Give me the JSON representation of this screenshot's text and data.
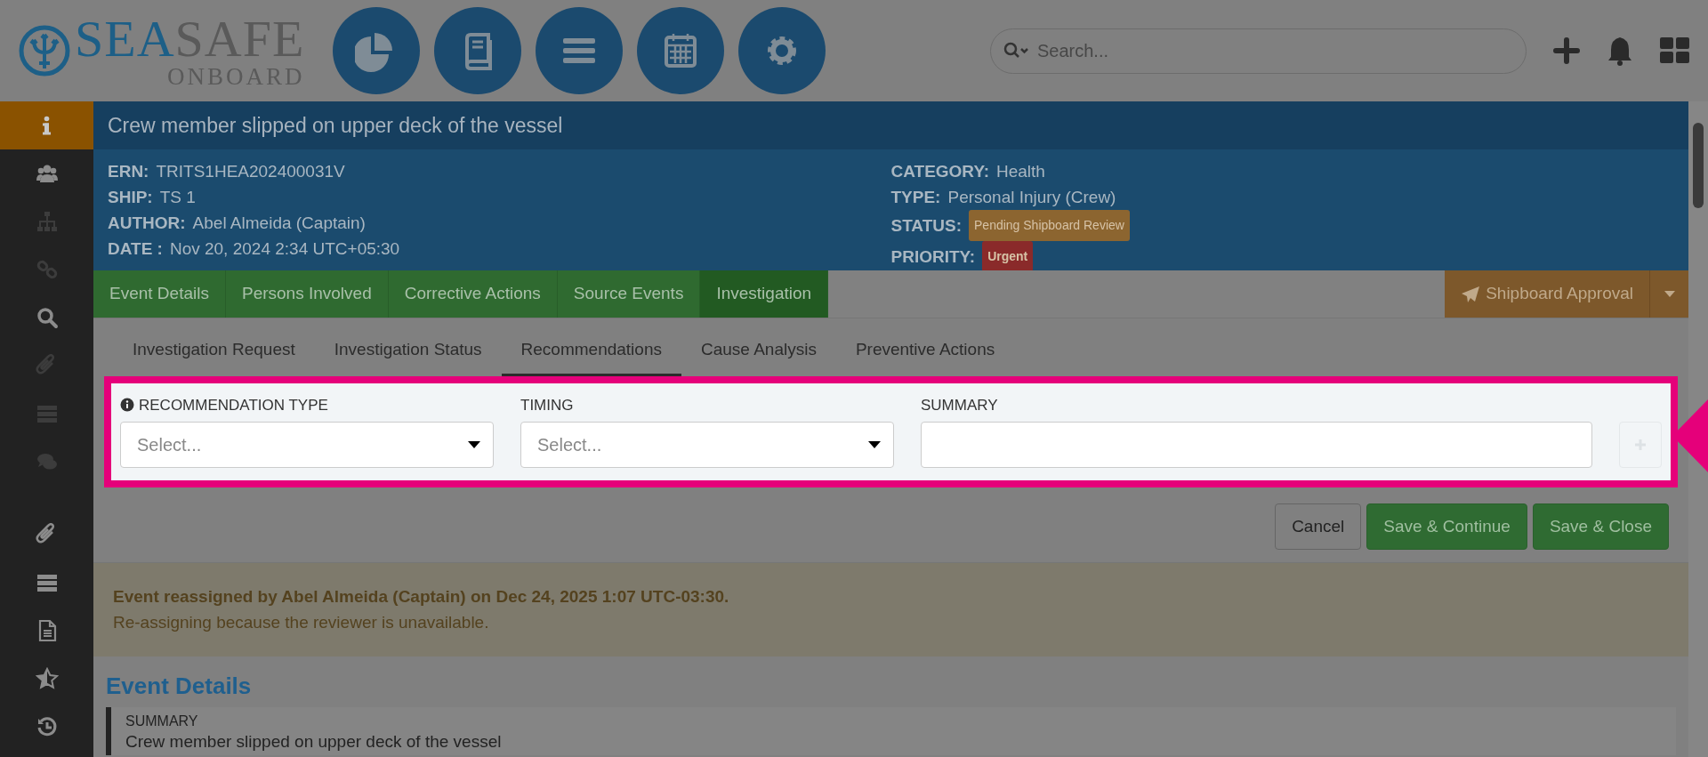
{
  "header": {
    "logo": {
      "brand_primary": "SEA",
      "brand_secondary": "SAFE",
      "tagline": "ONBOARD"
    },
    "search": {
      "placeholder": "Search..."
    }
  },
  "sidebar": {
    "items": [
      {
        "selected": true,
        "disabled": false
      },
      {
        "selected": false,
        "disabled": false
      },
      {
        "selected": false,
        "disabled": true
      },
      {
        "selected": false,
        "disabled": true
      },
      {
        "selected": false,
        "disabled": false
      },
      {
        "selected": false,
        "disabled": true
      },
      {
        "selected": false,
        "disabled": true
      },
      {
        "selected": false,
        "disabled": true
      }
    ],
    "bottom_items": [
      {
        "selected": false,
        "disabled": false
      },
      {
        "selected": false,
        "disabled": false
      },
      {
        "selected": false,
        "disabled": false
      },
      {
        "selected": false,
        "disabled": false
      },
      {
        "selected": false,
        "disabled": false
      }
    ]
  },
  "event": {
    "title": "Crew member slipped on upper deck of the vessel",
    "left_fields": [
      {
        "label": "ERN:",
        "value": "TRITS1HEA202400031V",
        "kind": "text"
      },
      {
        "label": "SHIP:",
        "value": "TS 1",
        "kind": "text"
      },
      {
        "label": "AUTHOR:",
        "value": "Abel Almeida (Captain)",
        "kind": "text"
      },
      {
        "label": "DATE :",
        "value": "Nov 20, 2024 2:34 UTC+05:30",
        "kind": "text"
      }
    ],
    "right_fields": [
      {
        "label": "CATEGORY:",
        "value": "Health",
        "kind": "text"
      },
      {
        "label": "TYPE:",
        "value": "Personal Injury (Crew)",
        "kind": "text"
      },
      {
        "label": "STATUS:",
        "value": "Pending Shipboard Review",
        "kind": "badge",
        "color": "#8c6530"
      },
      {
        "label": "PRIORITY:",
        "value": "Urgent",
        "kind": "badge",
        "color": "#8a2a2a"
      }
    ]
  },
  "tabs": [
    {
      "label": "Event Details",
      "selected": false
    },
    {
      "label": "Persons Involved",
      "selected": false
    },
    {
      "label": "Corrective Actions",
      "selected": false
    },
    {
      "label": "Source Events",
      "selected": false
    },
    {
      "label": "Investigation",
      "selected": true
    }
  ],
  "action_button": {
    "label": "Shipboard Approval"
  },
  "subtabs": [
    {
      "label": "Investigation Request",
      "selected": false
    },
    {
      "label": "Investigation Status",
      "selected": false
    },
    {
      "label": "Recommendations",
      "selected": true
    },
    {
      "label": "Cause Analysis",
      "selected": false
    },
    {
      "label": "Preventive Actions",
      "selected": false
    }
  ],
  "form": {
    "fields": [
      {
        "label": "RECOMMENDATION TYPE",
        "kind": "select",
        "placeholder": "Select...",
        "info": true
      },
      {
        "label": "TIMING",
        "kind": "select",
        "placeholder": "Select...",
        "info": false
      },
      {
        "label": "SUMMARY",
        "kind": "text",
        "info": false
      }
    ]
  },
  "buttons": [
    {
      "label": "Cancel",
      "kind": "secondary"
    },
    {
      "label": "Save & Continue",
      "kind": "primary"
    },
    {
      "label": "Save & Close",
      "kind": "primary"
    }
  ],
  "alert": {
    "title": "Event reassigned by Abel Almeida (Captain) on Dec 24, 2025 1:07 UTC-03:30.",
    "message": "Re-assigning because the reviewer is unavailable."
  },
  "section": {
    "heading": "Event Details",
    "summary_label": "SUMMARY",
    "summary_value": "Crew member slipped on upper deck of the vessel"
  }
}
